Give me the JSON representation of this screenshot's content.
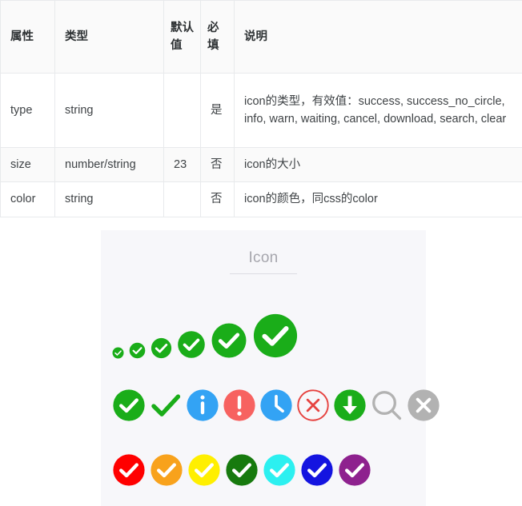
{
  "table": {
    "headers": [
      "属性",
      "类型",
      "默认值",
      "必填",
      "说明"
    ],
    "rows": [
      {
        "attr": "type",
        "type": "string",
        "default": "",
        "required": "是",
        "desc": "icon的类型，有效值：success, success_no_circle, info, warn, waiting, cancel, download, search, clear"
      },
      {
        "attr": "size",
        "type": "number/string",
        "default": "23",
        "required": "否",
        "desc": "icon的大小"
      },
      {
        "attr": "color",
        "type": "string",
        "default": "",
        "required": "否",
        "desc": "icon的颜色，同css的color"
      }
    ]
  },
  "demo": {
    "title": "Icon",
    "panel_background": "#f7f7fa",
    "size_row": {
      "icon": "success-circle-check-icon",
      "color": "#1aad19",
      "sizes": [
        15,
        21,
        27,
        36,
        46,
        58
      ]
    },
    "type_row": [
      {
        "name": "success",
        "label": "success",
        "color": "#1aad19"
      },
      {
        "name": "success_no_circle",
        "label": "success_no_circle",
        "color": "#1aad19"
      },
      {
        "name": "info",
        "label": "info",
        "color": "#33a3f4"
      },
      {
        "name": "warn",
        "label": "warn",
        "color": "#f76260"
      },
      {
        "name": "waiting",
        "label": "waiting",
        "color": "#33a3f4"
      },
      {
        "name": "cancel",
        "label": "cancel",
        "color": "#e64340"
      },
      {
        "name": "download",
        "label": "download",
        "color": "#1aad19"
      },
      {
        "name": "search",
        "label": "search",
        "color": "#b2b2b2"
      },
      {
        "name": "clear",
        "label": "clear",
        "color": "#b2b2b2"
      }
    ],
    "color_row": {
      "icon": "success-circle-check-icon",
      "colors": [
        "#ff0000",
        "#f8a21c",
        "#ffef00",
        "#177a0e",
        "#2cf0f0",
        "#1414e0",
        "#8e218e"
      ]
    }
  }
}
